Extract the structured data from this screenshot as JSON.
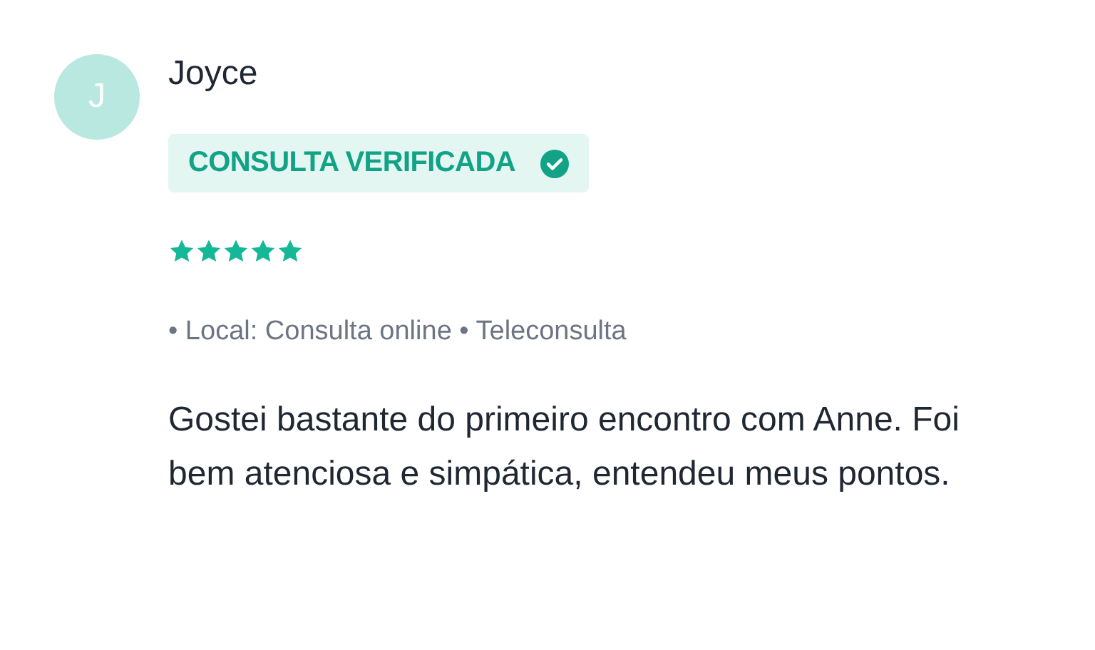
{
  "review": {
    "avatar_initial": "J",
    "author": "Joyce",
    "badge": {
      "label": "CONSULTA VERIFICADA",
      "verified": true
    },
    "stars": 5,
    "meta": "• Local: Consulta online • Teleconsulta",
    "text": "Gostei bastante do primeiro encontro com Anne. Foi bem atenciosa e simpática, entendeu meus pontos."
  }
}
